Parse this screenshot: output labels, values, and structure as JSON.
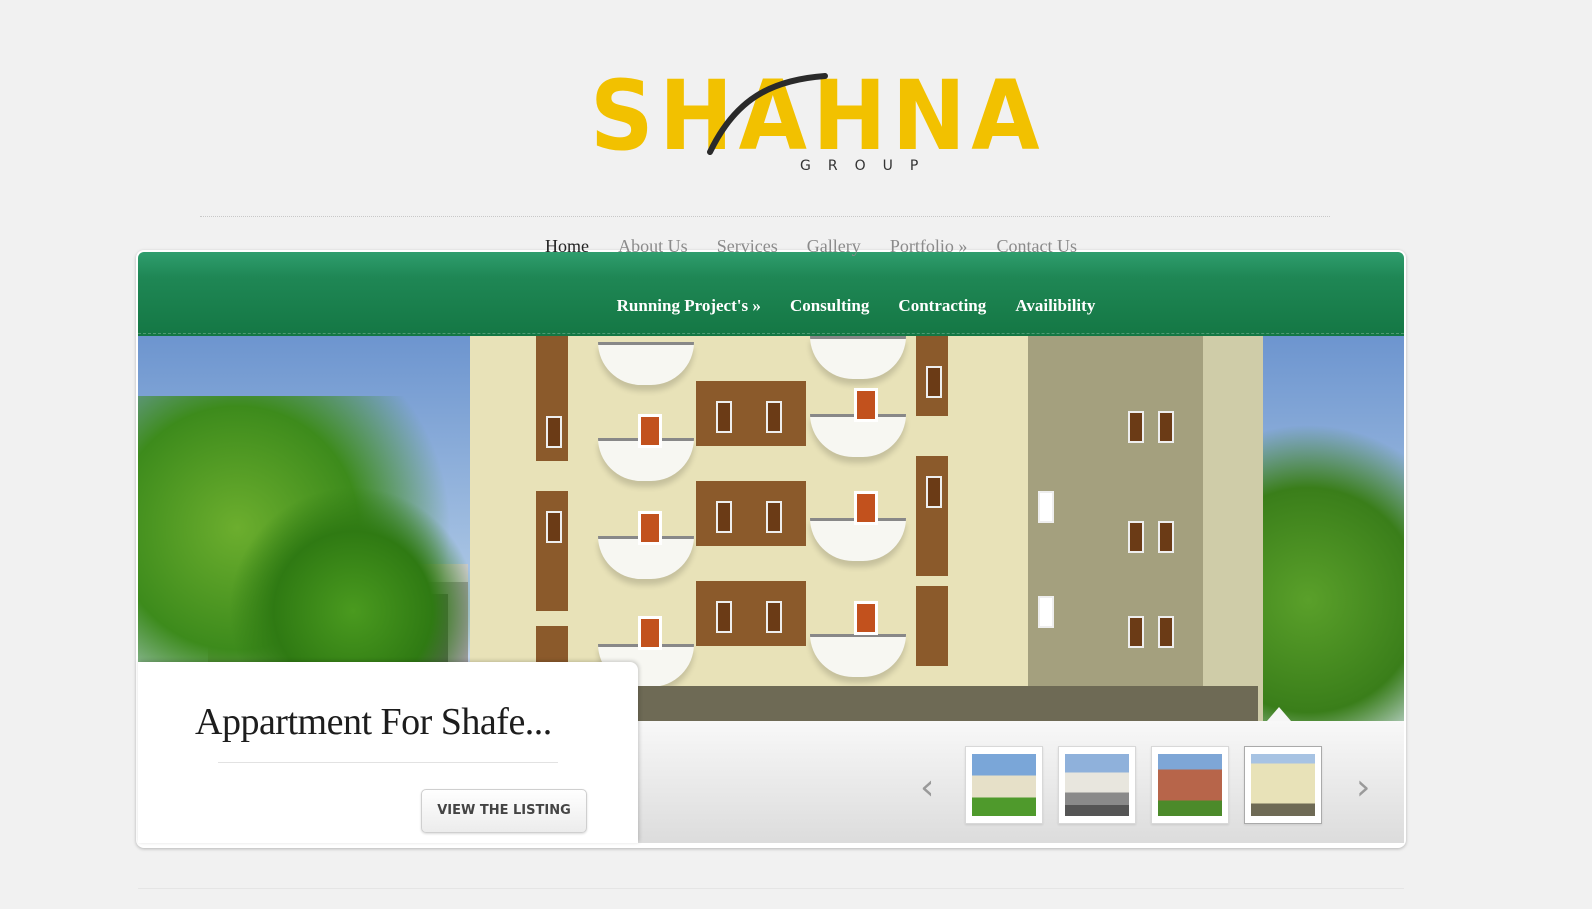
{
  "logo": {
    "text": "SHAHNA",
    "subtitle": "GROUP"
  },
  "top_nav": {
    "items": [
      {
        "label": "Home",
        "active": true
      },
      {
        "label": "About Us"
      },
      {
        "label": "Services"
      },
      {
        "label": "Gallery"
      },
      {
        "label": "Portfolio »"
      },
      {
        "label": "Contact Us"
      }
    ]
  },
  "sub_nav": {
    "items": [
      {
        "label": "Running Project's »"
      },
      {
        "label": "Consulting"
      },
      {
        "label": "Contracting"
      },
      {
        "label": "Availibility"
      }
    ]
  },
  "slider": {
    "caption_title": "Appartment For Shafe...",
    "button_label": "VIEW THE LISTING",
    "prev_icon": "‹",
    "next_icon": "›",
    "thumbnails_count": 4
  },
  "colors": {
    "brand_yellow": "#f2c100",
    "nav_green": "#1f8755"
  }
}
